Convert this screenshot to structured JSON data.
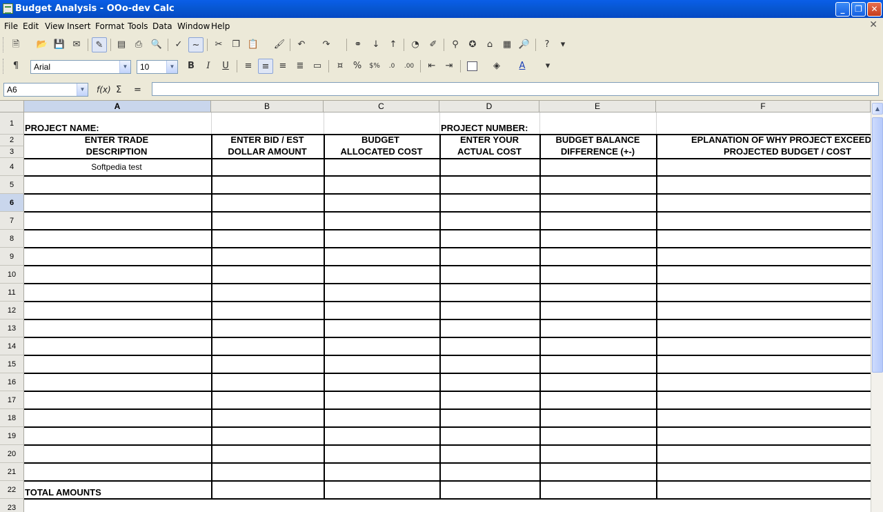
{
  "window": {
    "title": "Budget Analysis - OOo-dev Calc",
    "minimize": "_",
    "maximize": "❐",
    "close": "✕",
    "doc_close": "✕"
  },
  "menu": [
    "File",
    "Edit",
    "View",
    "Insert",
    "Format",
    "Tools",
    "Data",
    "Window",
    "Help"
  ],
  "formatting": {
    "font_name": "Arial",
    "font_size": "10"
  },
  "formula_bar": {
    "cell_ref": "A6",
    "function_wizard": "f(x)",
    "sum": "Σ",
    "equals": "=",
    "content": ""
  },
  "sheet": {
    "columns": [
      "A",
      "B",
      "C",
      "D",
      "E",
      "F"
    ],
    "rows": [
      "1",
      "2",
      "3",
      "4",
      "5",
      "6",
      "7",
      "8",
      "9",
      "10",
      "11",
      "12",
      "13",
      "14",
      "15",
      "16",
      "17",
      "18",
      "19",
      "20",
      "21",
      "22",
      "23"
    ],
    "selected_column": "A",
    "selected_row": "6",
    "project_name_label": "PROJECT NAME:",
    "project_number_label": "PROJECT NUMBER:",
    "headers": {
      "a1": "ENTER TRADE",
      "a2": "DESCRIPTION",
      "b1": "ENTER BID / EST",
      "b2": "DOLLAR AMOUNT",
      "c1": "BUDGET",
      "c2": "ALLOCATED COST",
      "d1": "ENTER YOUR",
      "d2": "ACTUAL COST",
      "e1": "BUDGET BALANCE",
      "e2": "DIFFERENCE (+-)",
      "f1": "EPLANATION OF WHY PROJECT EXCEED",
      "f2": "PROJECTED BUDGET / COST"
    },
    "a4_value": "Softpedia test",
    "total_label": "TOTAL AMOUNTS"
  },
  "colors": {
    "titlebar": "#0757d2",
    "chrome": "#ece9d8",
    "header_selected": "#c9d6ec"
  }
}
